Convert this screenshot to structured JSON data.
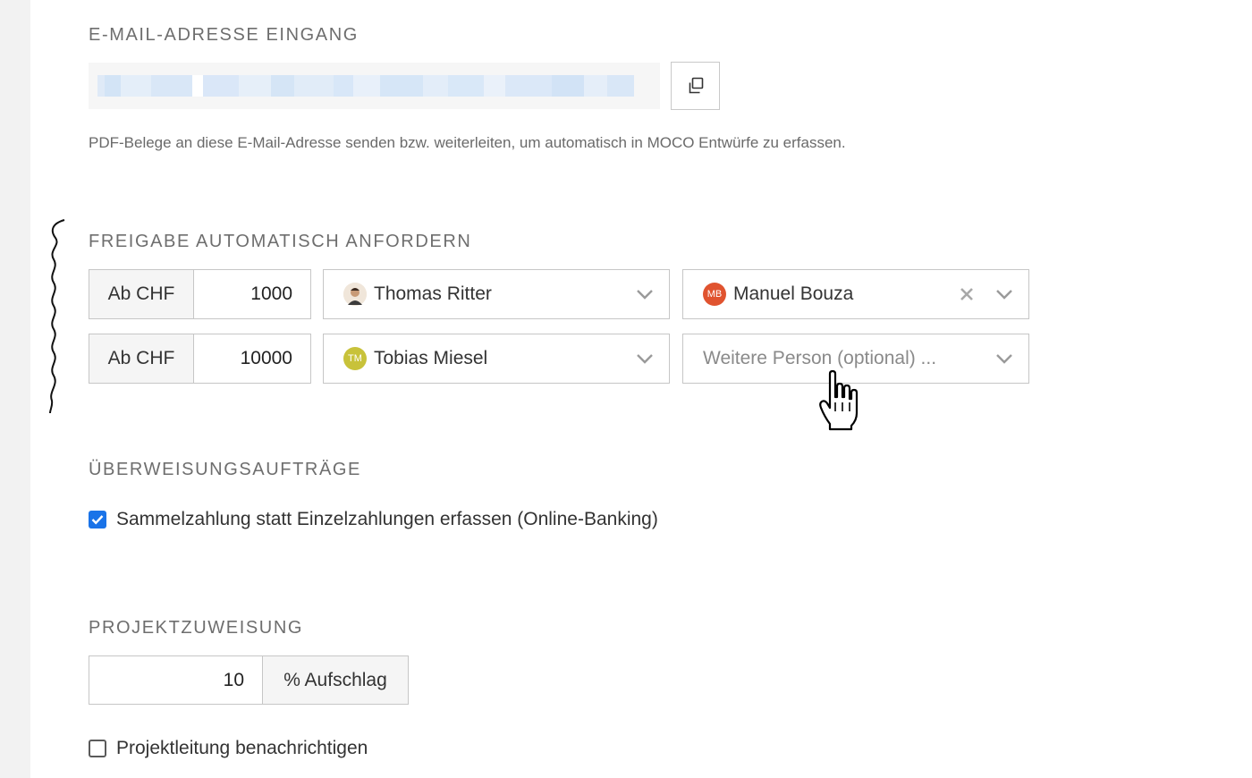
{
  "email_section": {
    "title": "E-MAIL-ADRESSE EINGANG",
    "hint": "PDF-Belege an diese E-Mail-Adresse senden bzw. weiterleiten, um automatisch in MOCO Entwürfe zu erfassen.",
    "copy_icon": "copy-icon"
  },
  "approval_section": {
    "title": "FREIGABE AUTOMATISCH ANFORDERN",
    "rows": [
      {
        "prefix": "Ab CHF",
        "amount": "1000",
        "approver1": {
          "name": "Thomas Ritter",
          "avatar": "photo"
        },
        "approver2": {
          "name": "Manuel Bouza",
          "initials": "MB",
          "color": "#e0532f"
        }
      },
      {
        "prefix": "Ab CHF",
        "amount": "10000",
        "approver1": {
          "name": "Tobias Miesel",
          "initials": "TM",
          "color": "#c8c23a"
        },
        "approver2": {
          "placeholder": "Weitere Person (optional) ..."
        }
      }
    ]
  },
  "transfer_section": {
    "title": "ÜBERWEISUNGSAUFTRÄGE",
    "checkbox_label": "Sammelzahlung statt Einzelzahlungen erfassen (Online-Banking)",
    "checked": true
  },
  "project_section": {
    "title": "PROJEKTZUWEISUNG",
    "value": "10",
    "suffix": "% Aufschlag",
    "checkbox_label": "Projektleitung benachrichtigen",
    "checked": false
  },
  "colors": {
    "accent": "#1a73e8",
    "border": "#c6c6c6",
    "muted_text": "#6e6e6e"
  }
}
